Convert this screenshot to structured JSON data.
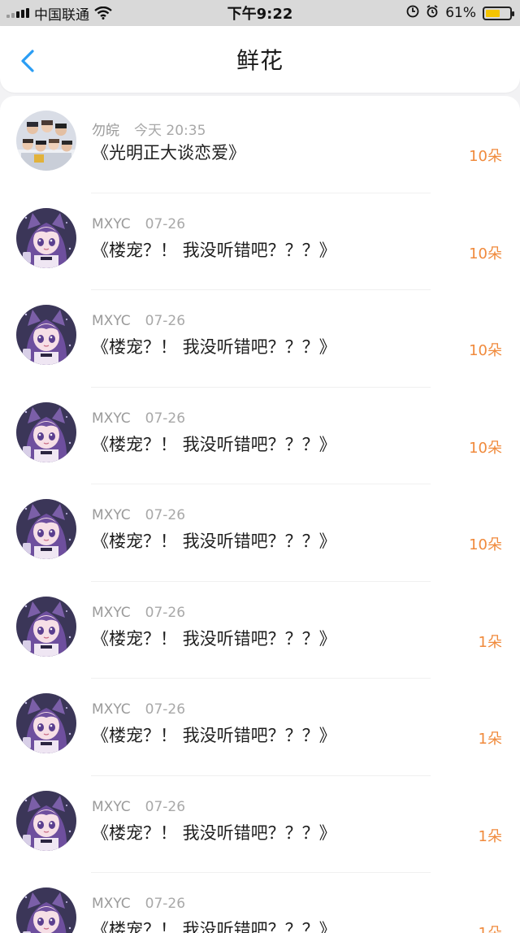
{
  "status_bar": {
    "carrier": "中国联通",
    "time": "下午9:22",
    "battery_percent": "61%",
    "battery_level": 0.61,
    "icons": [
      "signal-icon",
      "wifi-icon",
      "location-lock-icon",
      "alarm-icon",
      "battery-icon"
    ]
  },
  "header": {
    "back_icon": "chevron-left-icon",
    "title": "鲜花"
  },
  "colors": {
    "accent_blue": "#2a9df4",
    "count_orange": "#f08a3c",
    "battery_yellow": "#f4c400"
  },
  "rows": [
    {
      "user": "勿皖",
      "time": "今天 20:35",
      "message": "《光明正大谈恋爱》",
      "count": "10朵",
      "avatar": "group-photo"
    },
    {
      "user": "MXYC",
      "time": "07-26",
      "message": "《楼宠？！ 我没听错吧？？？》",
      "count": "10朵",
      "avatar": "anime-girl"
    },
    {
      "user": "MXYC",
      "time": "07-26",
      "message": "《楼宠？！ 我没听错吧？？？》",
      "count": "10朵",
      "avatar": "anime-girl"
    },
    {
      "user": "MXYC",
      "time": "07-26",
      "message": "《楼宠？！ 我没听错吧？？？》",
      "count": "10朵",
      "avatar": "anime-girl"
    },
    {
      "user": "MXYC",
      "time": "07-26",
      "message": "《楼宠？！ 我没听错吧？？？》",
      "count": "10朵",
      "avatar": "anime-girl"
    },
    {
      "user": "MXYC",
      "time": "07-26",
      "message": "《楼宠？！ 我没听错吧？？？》",
      "count": "1朵",
      "avatar": "anime-girl"
    },
    {
      "user": "MXYC",
      "time": "07-26",
      "message": "《楼宠？！ 我没听错吧？？？》",
      "count": "1朵",
      "avatar": "anime-girl"
    },
    {
      "user": "MXYC",
      "time": "07-26",
      "message": "《楼宠？！ 我没听错吧？？？》",
      "count": "1朵",
      "avatar": "anime-girl"
    },
    {
      "user": "MXYC",
      "time": "07-26",
      "message": "《楼宠？！ 我没听错吧？？？》",
      "count": "1朵",
      "avatar": "anime-girl"
    }
  ]
}
